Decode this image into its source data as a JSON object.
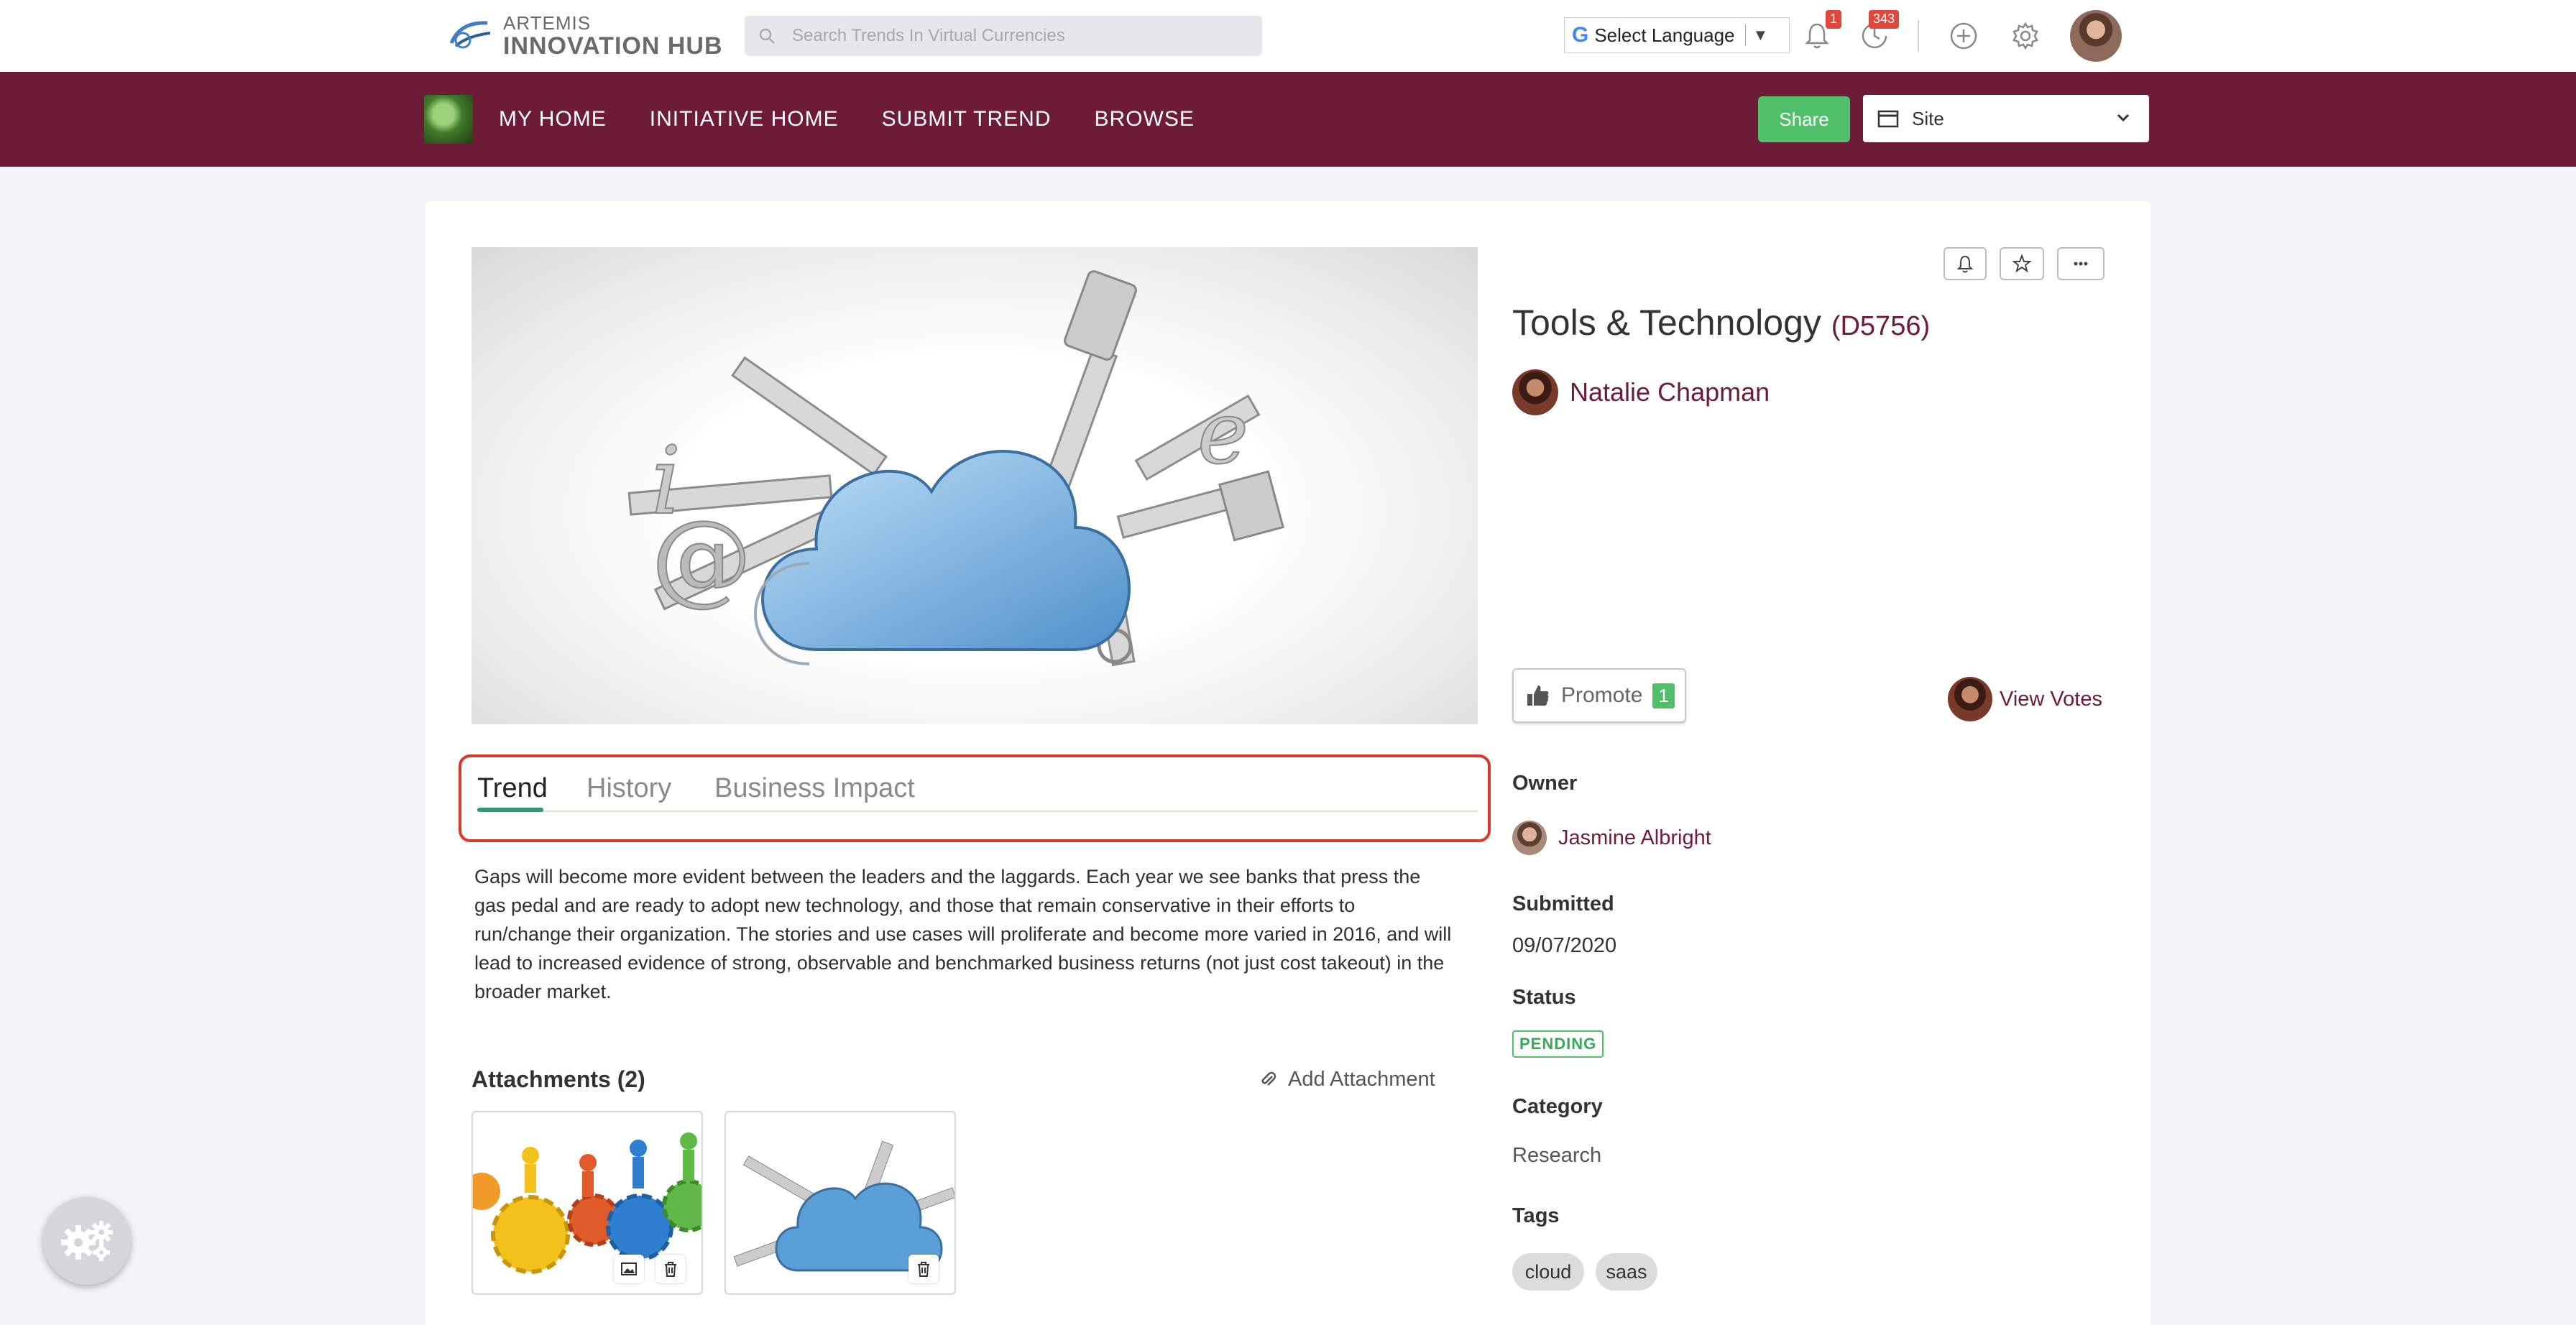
{
  "header": {
    "logo_line1": "ARTEMIS",
    "logo_line2": "INNOVATION HUB",
    "search_placeholder": "Search Trends In Virtual Currencies",
    "language_label": "Select Language",
    "notifications_count": "1",
    "activity_count": "343"
  },
  "nav": {
    "items": [
      "MY HOME",
      "INITIATIVE HOME",
      "SUBMIT TREND",
      "BROWSE"
    ],
    "share_label": "Share",
    "site_label": "Site"
  },
  "tabs": [
    "Trend",
    "History",
    "Business Impact"
  ],
  "description": "Gaps will become more evident between the leaders and the laggards. Each year we see banks that press the gas pedal and are ready to adopt new technology, and those that remain conservative in their efforts to run/change their organization. The stories and use cases will proliferate and become more varied in 2016, and will lead to increased evidence of strong, observable and benchmarked business returns (not just cost takeout) in the broader market.",
  "attachments": {
    "title": "Attachments (2)",
    "add_label": "Add Attachment"
  },
  "detail": {
    "title": "Tools & Technology",
    "code": "(D5756)",
    "author": "Natalie Chapman",
    "promote_label": "Promote",
    "promote_count": "1",
    "view_votes_label": "View Votes",
    "owner_label": "Owner",
    "owner_name": "Jasmine Albright",
    "submitted_label": "Submitted",
    "submitted_date": "09/07/2020",
    "status_label": "Status",
    "status_value": "PENDING",
    "category_label": "Category",
    "category_value": "Research",
    "tags_label": "Tags",
    "tags": [
      "cloud",
      "saas"
    ]
  },
  "colors": {
    "brand": "#6e1b38",
    "accent_green": "#4fbf69",
    "highlight_red": "#d9382c"
  }
}
